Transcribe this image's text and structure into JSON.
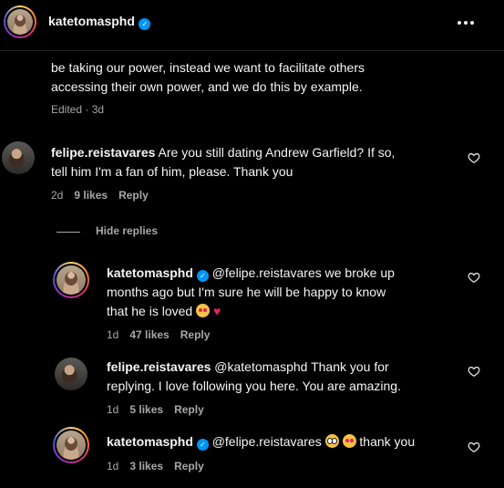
{
  "header": {
    "username": "katetomasphd",
    "verified": "✓",
    "more_icon": "more-horizontal-icon"
  },
  "caption": {
    "line1": "be taking our power, instead we want to facilitate others",
    "line2": "accessing their own power, and we do this by example.",
    "edited": "Edited · 3d"
  },
  "comments": [
    {
      "username": "felipe.reistavares",
      "text_a": "Are you still dating Andrew Garfield? If so,",
      "text_b": "tell him I'm a fan of him, please. Thank you",
      "time": "2d",
      "likes": "9 likes",
      "reply": "Reply"
    }
  ],
  "hide_replies": "Hide replies",
  "replies": [
    {
      "username": "katetomasphd",
      "mention": "@felipe.reistavares",
      "text_a": " we broke up",
      "text_b": "months ago but I'm sure he will be happy to know",
      "text_c": "that he is loved",
      "heart": "♥",
      "time": "1d",
      "likes": "47 likes",
      "reply": "Reply"
    },
    {
      "username": "felipe.reistavares",
      "mention": "@katetomasphd",
      "text_a": " Thank you for",
      "text_b": "replying. I love following you here. You are amazing.",
      "time": "1d",
      "likes": "5 likes",
      "reply": "Reply"
    },
    {
      "username": "katetomasphd",
      "mention": "@felipe.reistavares",
      "text_a": "thank you",
      "time": "1d",
      "likes": "3 likes",
      "reply": "Reply"
    }
  ],
  "colors": {
    "background": "#000000",
    "text": "#f5f5f5",
    "secondary": "#a8a8a8",
    "verified": "#0095f6"
  }
}
